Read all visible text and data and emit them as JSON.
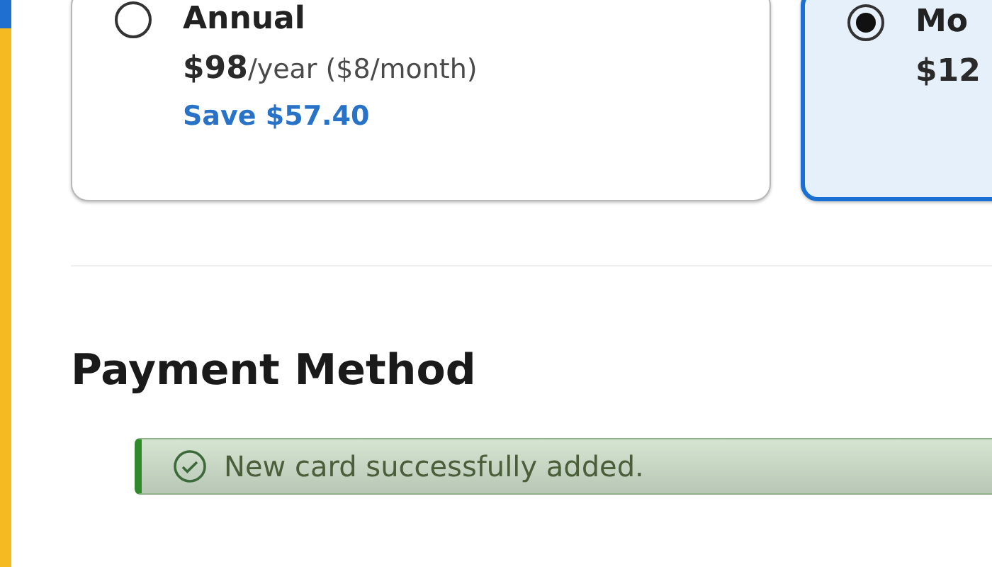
{
  "plans": [
    {
      "name": "Annual",
      "price": "$98",
      "period": "/year ($8/month)",
      "savings": "Save $57.40",
      "selected": false
    },
    {
      "name": "Mo",
      "price": "$12",
      "selected": true
    }
  ],
  "payment": {
    "heading": "Payment Method",
    "alert": "New card successfully added."
  }
}
